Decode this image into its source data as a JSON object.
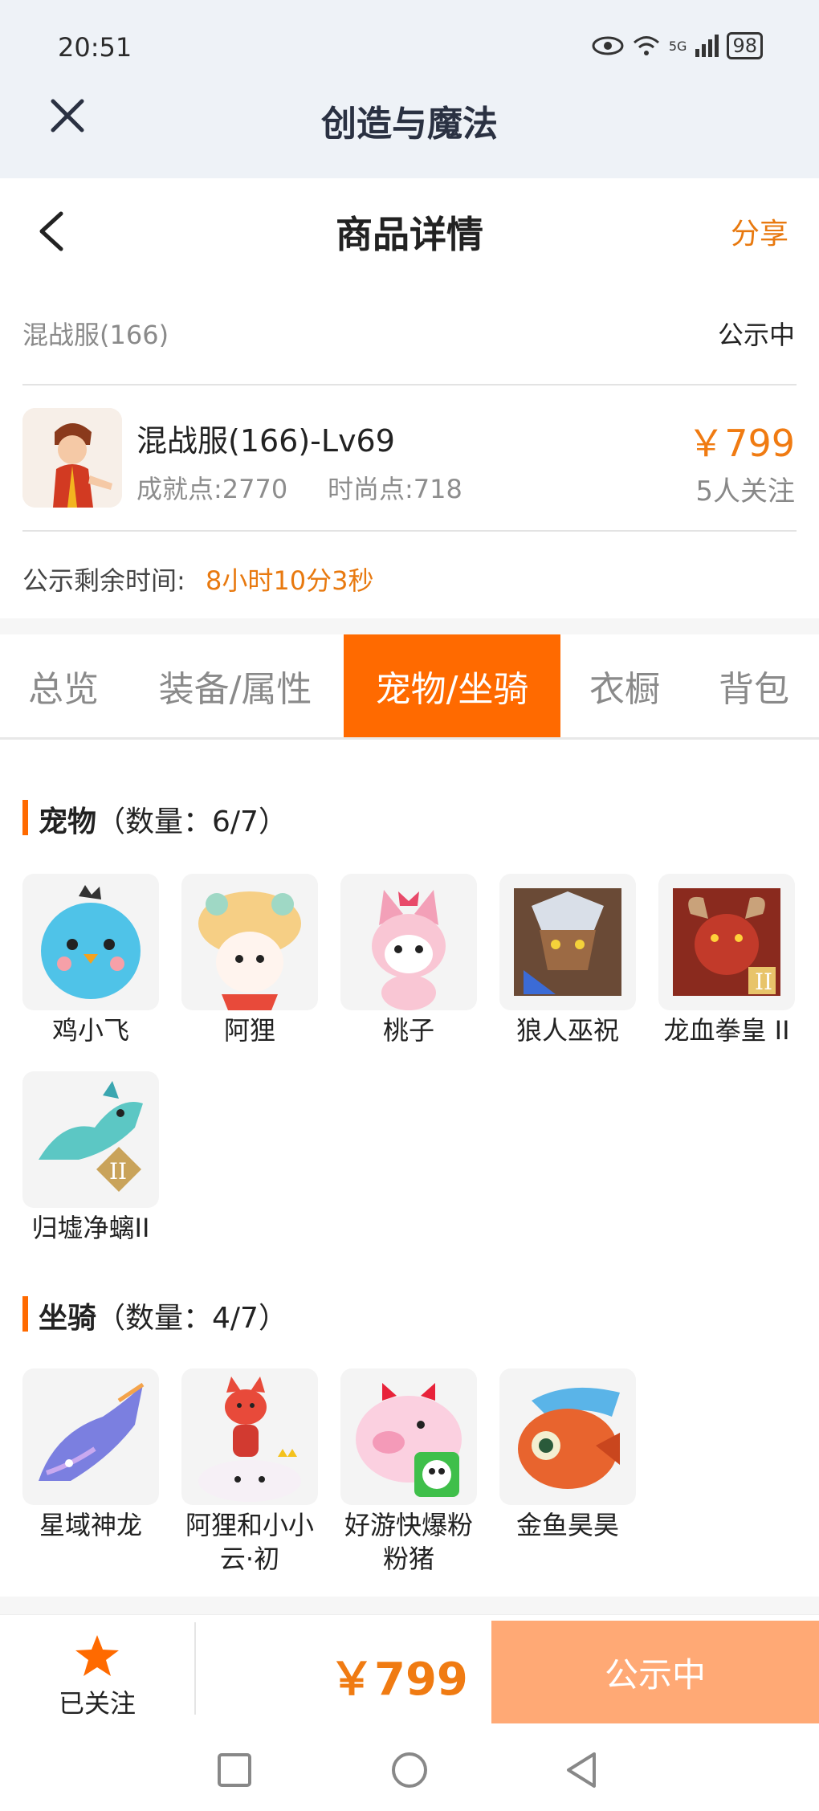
{
  "status_bar": {
    "time": "20:51",
    "network": "5G",
    "battery": "98"
  },
  "app": {
    "title": "创造与魔法"
  },
  "header": {
    "title": "商品详情",
    "share": "分享"
  },
  "server": {
    "name": "混战服(166)",
    "status": "公示中"
  },
  "item": {
    "title": "混战服(166)-Lv69",
    "achievement": "成就点:2770",
    "fashion": "时尚点:718",
    "price": "￥799",
    "followers": "5人关注"
  },
  "remaining": {
    "label": "公示剩余时间:",
    "value": "8小时10分3秒"
  },
  "tabs": [
    {
      "label": "总览"
    },
    {
      "label": "装备/属性"
    },
    {
      "label": "宠物/坐骑"
    },
    {
      "label": "衣橱"
    },
    {
      "label": "背包"
    }
  ],
  "pets": {
    "title": "宠物",
    "count": "（数量：6/7）",
    "items": [
      {
        "name": "鸡小飞"
      },
      {
        "name": "阿狸"
      },
      {
        "name": "桃子"
      },
      {
        "name": "狼人巫祝"
      },
      {
        "name": "龙血拳皇 II"
      },
      {
        "name": "归墟净螭II"
      }
    ]
  },
  "mounts": {
    "title": "坐骑",
    "count": "（数量：4/7）",
    "items": [
      {
        "name": "星域神龙"
      },
      {
        "name": "阿狸和小小云·初"
      },
      {
        "name": "好游快爆粉粉猪"
      },
      {
        "name": "金鱼昊昊"
      }
    ]
  },
  "bottom": {
    "follow_label": "已关注",
    "price": "￥799",
    "action": "公示中"
  },
  "colors": {
    "accent": "#ff6a00",
    "price": "#f07b12",
    "action_bg": "#ffa975"
  }
}
